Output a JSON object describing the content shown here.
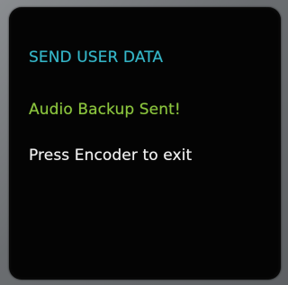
{
  "screen": {
    "title": "SEND USER DATA",
    "status": "Audio Backup Sent!",
    "instruction": "Press Encoder to exit"
  },
  "colors": {
    "title": "#35b7c9",
    "status": "#8cc63e",
    "instruction": "#f4f4f4",
    "screen_background": "#040404",
    "bezel": "#6f7276"
  }
}
